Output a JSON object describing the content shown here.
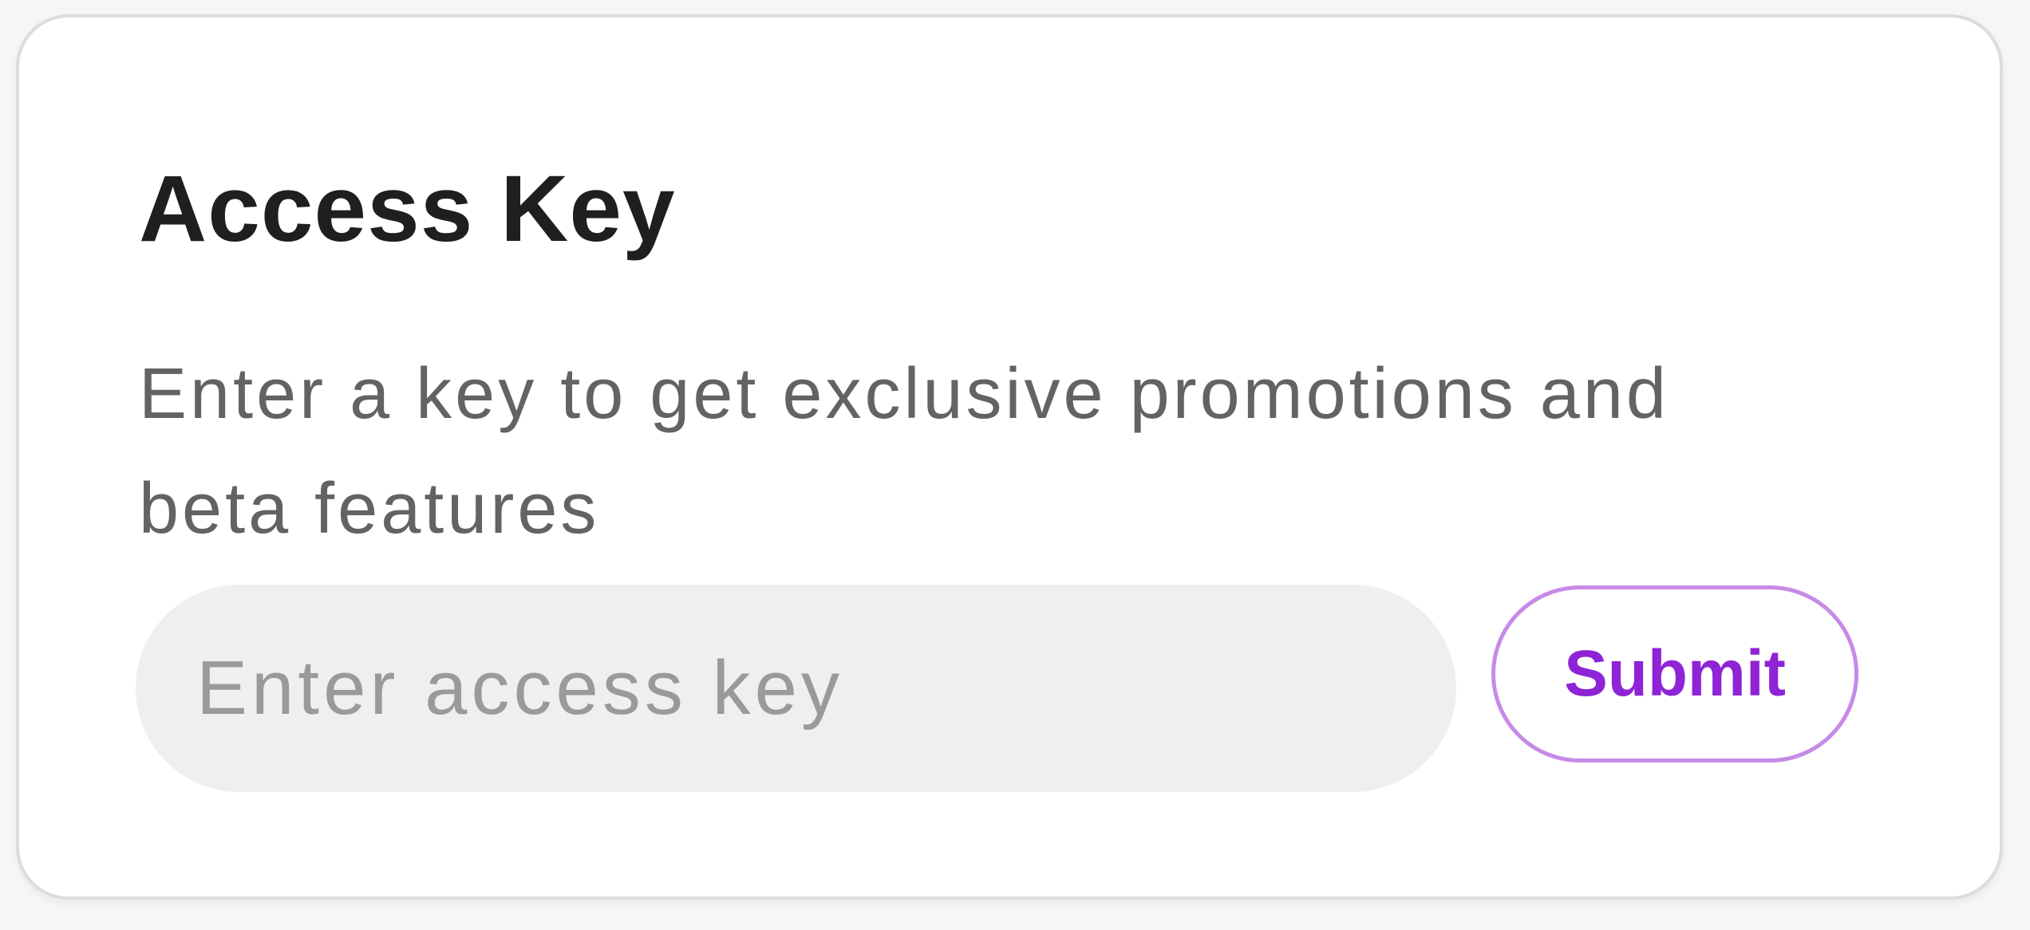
{
  "card": {
    "title": "Access Key",
    "description": "Enter a key to get exclusive promotions and beta features"
  },
  "form": {
    "input_value": "",
    "input_placeholder": "Enter access key",
    "submit_label": "Submit"
  },
  "colors": {
    "accent": "#8e24d6",
    "accent_border": "#c78ae6",
    "input_background": "#efefef",
    "title_text": "#1f1f1f",
    "body_text": "#636363"
  }
}
